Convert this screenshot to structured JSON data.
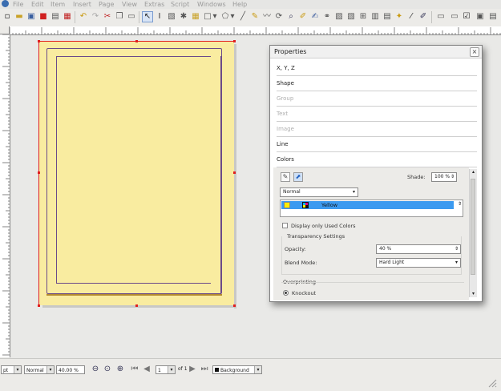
{
  "menu": {
    "items": [
      "File",
      "Edit",
      "Item",
      "Insert",
      "Page",
      "View",
      "Extras",
      "Script",
      "Windows",
      "Help"
    ]
  },
  "toolbar": {
    "icons": [
      "new-document-icon",
      "open-icon",
      "save-icon",
      "close-doc-icon",
      "print-icon",
      "pdf-icon",
      "undo-icon",
      "redo-icon",
      "cut-icon",
      "copy-icon",
      "paste-icon",
      "select-icon",
      "text-frame-icon",
      "image-frame-icon",
      "render-frame-icon",
      "table-icon",
      "shape-icon",
      "polygon-icon",
      "line-icon",
      "bezier-icon",
      "freehand-icon",
      "rotate-icon",
      "zoom-icon",
      "edit-contents-icon",
      "edit-text-icon",
      "link-frames-icon",
      "unlink-frames-icon",
      "measure-icon",
      "copy-properties-icon",
      "eyedropper-icon",
      "pdf-button-icon",
      "pdf-textfield-icon",
      "pdf-checkbox-icon",
      "pdf-combobox-icon"
    ]
  },
  "properties": {
    "title": "Properties",
    "close_glyph": "×",
    "sections": [
      {
        "label": "X, Y, Z",
        "enabled": true
      },
      {
        "label": "Shape",
        "enabled": true
      },
      {
        "label": "Group",
        "enabled": false
      },
      {
        "label": "Text",
        "enabled": false
      },
      {
        "label": "Image",
        "enabled": false
      },
      {
        "label": "Line",
        "enabled": true
      },
      {
        "label": "Colors",
        "enabled": true
      }
    ],
    "colors": {
      "shade_label": "Shade:",
      "shade_value": "100 %",
      "mode_value": "Normal",
      "selected_color": "Yellow",
      "display_only_used_colors": "Display only Used Colors",
      "transparency_settings": "Transparency Settings",
      "opacity_label": "Opacity:",
      "opacity_value": "40 %",
      "blend_mode_label": "Blend Mode:",
      "blend_mode_value": "Hard Light",
      "overprinting_label": "Overprinting",
      "knockout_label": "Knockout"
    }
  },
  "statusbar": {
    "unit_value": "pt",
    "mode_value": "Normal",
    "zoom_value": "40.00 %",
    "page_number": "1",
    "page_of": "of 1",
    "layer_value": "Background"
  },
  "colors": {
    "page_fill": "#f9eca0",
    "selection": "#e02020",
    "margin_guide": "#6b4a8a",
    "list_highlight": "#3b9af0",
    "swatch_yellow": "#ffee00"
  }
}
